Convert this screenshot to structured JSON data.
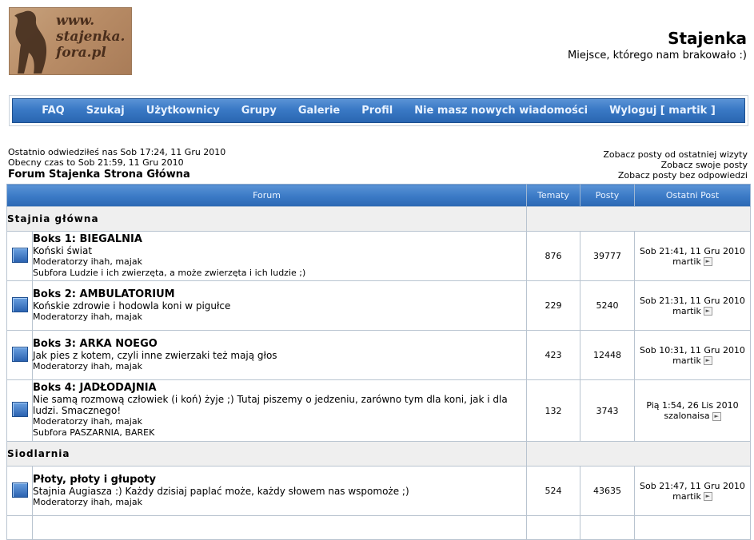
{
  "logo": {
    "lines": [
      "www.",
      "stajenka.",
      "fora.pl"
    ]
  },
  "site": {
    "title": "Stajenka",
    "description": "Miejsce, którego nam brakowało :)"
  },
  "nav": [
    "FAQ",
    "Szukaj",
    "Użytkownicy",
    "Grupy",
    "Galerie",
    "Profil",
    "Nie masz nowych wiadomości",
    "Wyloguj [ martik ]"
  ],
  "info": {
    "last_visit": "Ostatnio odwiedziłeś nas Sob 17:24, 11 Gru 2010",
    "current_time": "Obecny czas to Sob 21:59, 11 Gru 2010",
    "forum_home": "Forum Stajenka Strona Główna",
    "links": [
      "Zobacz posty od ostatniej wizyty",
      "Zobacz swoje posty",
      "Zobacz posty bez odpowiedzi"
    ]
  },
  "table": {
    "headers": [
      "Forum",
      "Tematy",
      "Posty",
      "Ostatni Post"
    ],
    "categories": [
      {
        "name": "Stajnia główna",
        "forums": [
          {
            "name": "Boks 1: BIEGALNIA",
            "desc": "Koński świat",
            "mods": "Moderatorzy ihah, majak",
            "sub": "Subfora Ludzie i ich zwierzęta, a może zwierzęta i ich ludzie ;)",
            "topics": "876",
            "posts": "39777",
            "last_date": "Sob 21:41, 11 Gru 2010",
            "last_user": "martik"
          },
          {
            "name": "Boks 2: AMBULATORIUM",
            "desc": "Końskie zdrowie i hodowla koni w pigułce",
            "mods": "Moderatorzy ihah, majak",
            "sub": "",
            "topics": "229",
            "posts": "5240",
            "last_date": "Sob 21:31, 11 Gru 2010",
            "last_user": "martik"
          },
          {
            "name": "Boks 3: ARKA NOEGO",
            "desc": "Jak pies z kotem, czyli inne zwierzaki też mają głos",
            "mods": "Moderatorzy ihah, majak",
            "sub": "",
            "topics": "423",
            "posts": "12448",
            "last_date": "Sob 10:31, 11 Gru 2010",
            "last_user": "martik"
          },
          {
            "name": "Boks 4: JADŁODAJNIA",
            "desc": "Nie samą rozmową człowiek (i koń) żyje ;) Tutaj piszemy o jedzeniu, zarówno tym dla koni, jak i dla ludzi. Smacznego!",
            "mods": "Moderatorzy ihah, majak",
            "sub": "Subfora PASZARNIA, BAREK",
            "topics": "132",
            "posts": "3743",
            "last_date": "Pią 1:54, 26 Lis 2010",
            "last_user": "szalonaisa"
          }
        ]
      },
      {
        "name": "Siodlarnia",
        "forums": [
          {
            "name": "Płoty, płoty i głupoty",
            "desc": "Stajnia Augiasza :) Każdy dzisiaj paplać może, każdy słowem nas wspomoże ;)",
            "mods": "Moderatorzy ihah, majak",
            "sub": "",
            "topics": "524",
            "posts": "43635",
            "last_date": "Sob 21:47, 11 Gru 2010",
            "last_user": "martik"
          }
        ]
      }
    ]
  }
}
